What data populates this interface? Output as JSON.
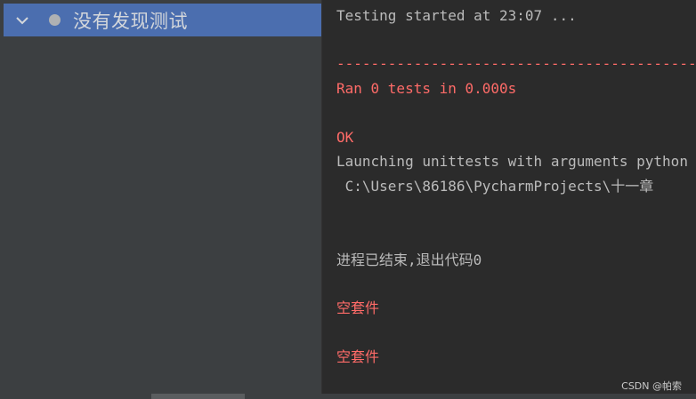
{
  "test_tree": {
    "root_item": {
      "expand_icon": "chevron-down-icon",
      "status_icon": "gray-dot-status",
      "label": "没有发现测试"
    }
  },
  "console": {
    "lines": [
      "Testing started at 23:07 ...",
      "------------------------------------------------------------",
      "Ran 0 tests in 0.000s",
      "OK",
      "Launching unittests with arguments python",
      " C:\\Users\\86186\\PycharmProjects\\十一章",
      "进程已结束,退出代码0",
      "空套件",
      "空套件"
    ]
  },
  "colors": {
    "selection": "#4b6eaf",
    "panel": "#3c3f41",
    "console_bg": "#2b2b2b",
    "text_gray": "#bbbbbb",
    "text_red": "#ff6b68"
  },
  "watermark": "CSDN @帕索"
}
